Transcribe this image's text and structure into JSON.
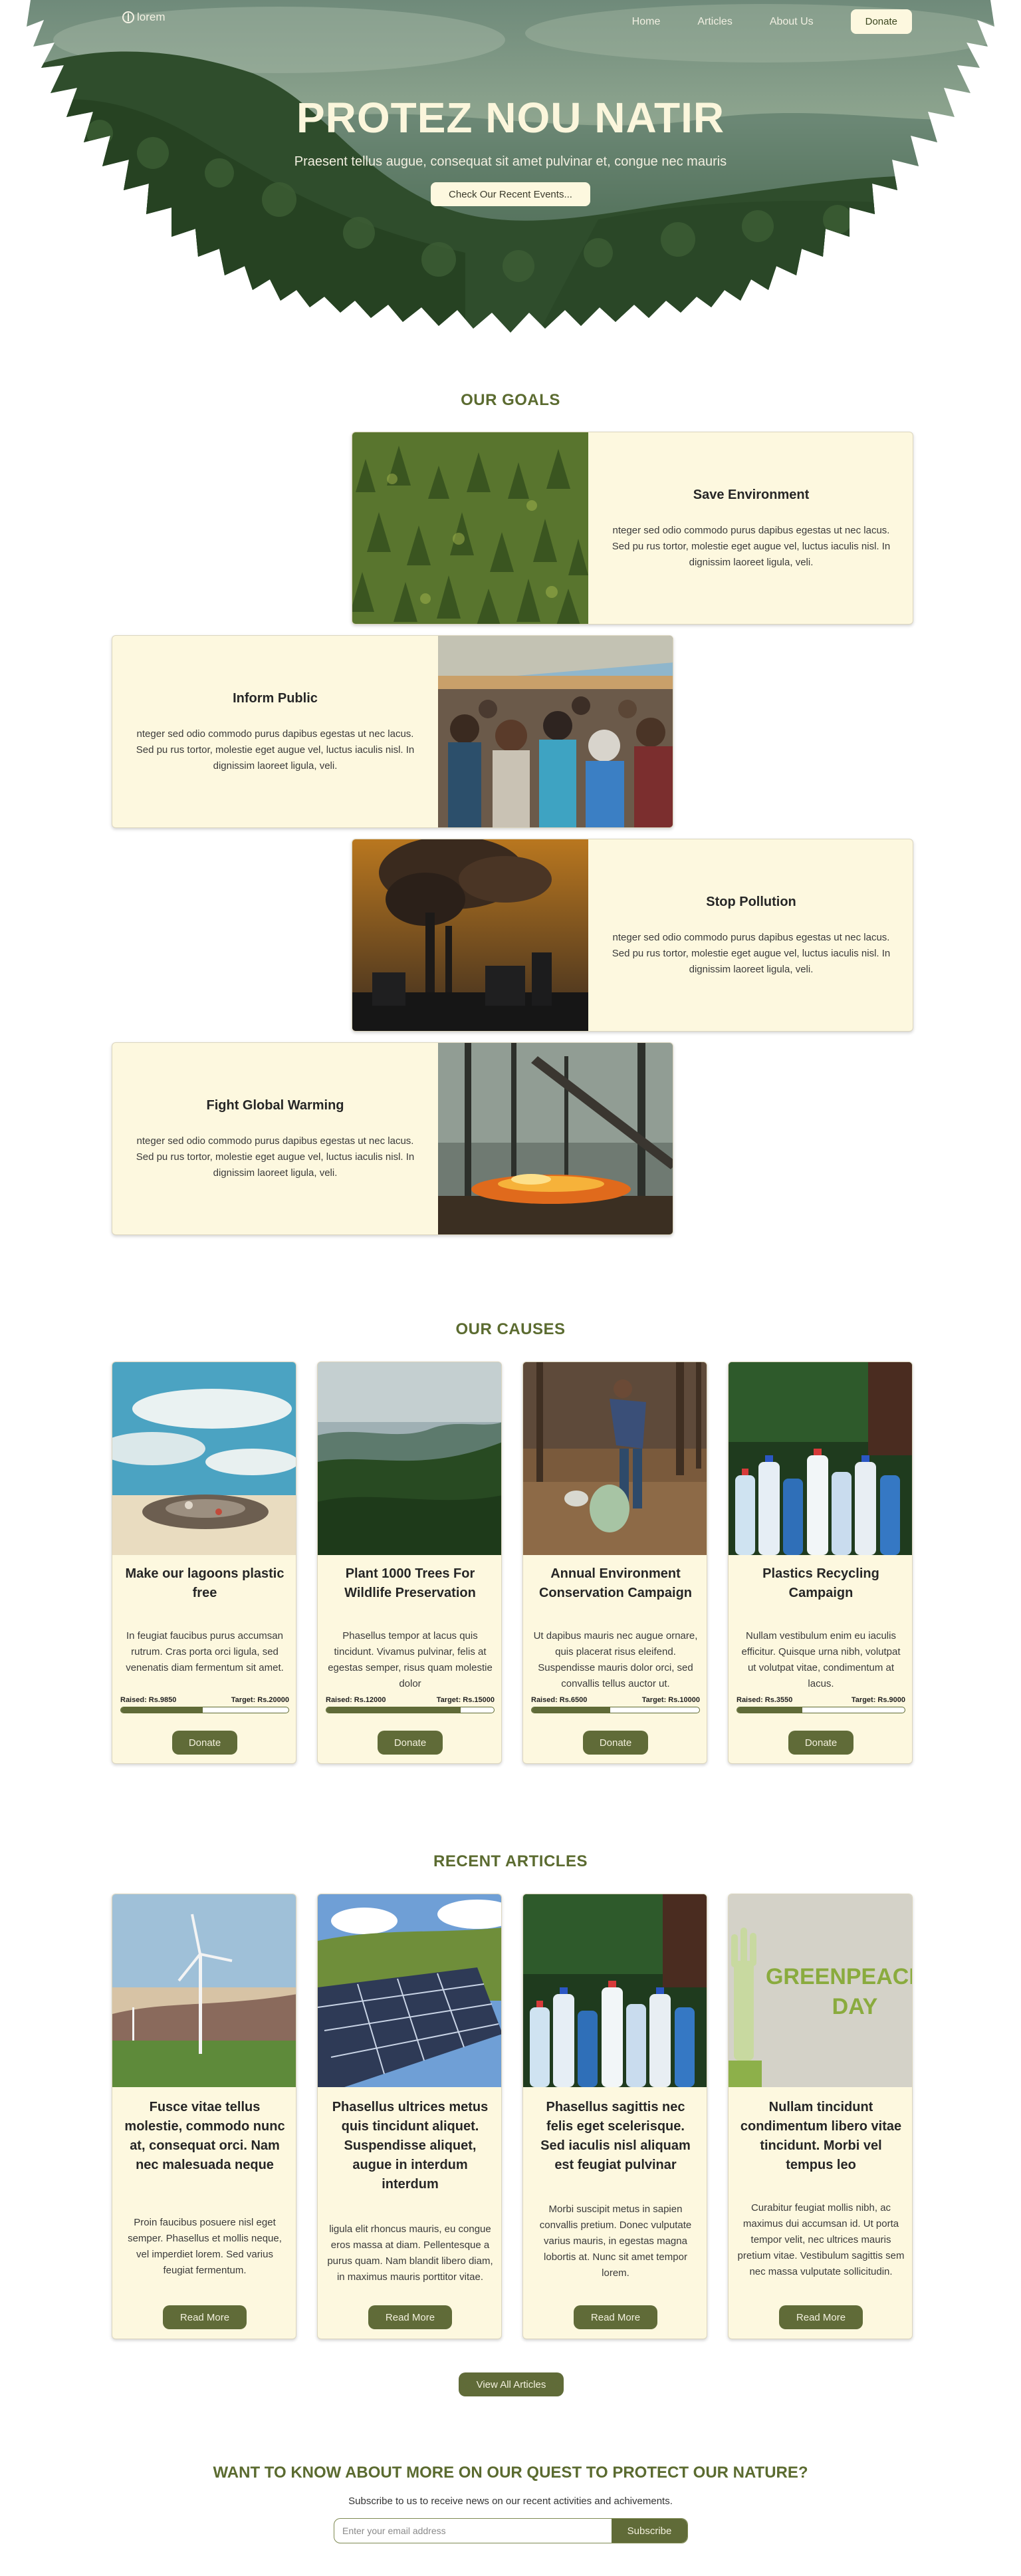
{
  "nav": {
    "logo_text": "lorem",
    "links": [
      "Home",
      "Articles",
      "About Us"
    ],
    "donate_label": "Donate"
  },
  "hero": {
    "title": "PROTEZ NOU NATIR",
    "subtitle": "Praesent tellus augue, consequat sit amet pulvinar et, congue nec mauris",
    "button": "Check Our Recent Events..."
  },
  "goals": {
    "title": "OUR GOALS",
    "items": [
      {
        "title": "Save Environment",
        "text": "nteger sed odio commodo purus dapibus egestas ut nec lacus. Sed pu rus tortor, molestie eget augue vel, luctus iaculis nisl. In dignissim laoreet ligula, veli.",
        "image": "pine-forest-photo"
      },
      {
        "title": "Inform Public",
        "text": "nteger sed odio commodo purus dapibus egestas ut nec lacus. Sed pu rus tortor, molestie eget augue vel, luctus iaculis nisl. In dignissim laoreet ligula, veli.",
        "image": "crowd-photo"
      },
      {
        "title": "Stop Pollution",
        "text": "nteger sed odio commodo purus dapibus egestas ut nec lacus. Sed pu rus tortor, molestie eget augue vel, luctus iaculis nisl. In dignissim laoreet ligula, veli.",
        "image": "factory-smoke-photo"
      },
      {
        "title": "Fight Global Warming",
        "text": "nteger sed odio commodo purus dapibus egestas ut nec lacus. Sed pu rus tortor, molestie eget augue vel, luctus iaculis nisl. In dignissim laoreet ligula, veli.",
        "image": "forest-fire-photo"
      }
    ]
  },
  "causes": {
    "title": "OUR CAUSES",
    "items": [
      {
        "title": "Make our lagoons plastic free",
        "text": "In feugiat faucibus purus accumsan rutrum. Cras porta orci ligula, sed venenatis diam fermentum sit amet.",
        "raised": "Raised: Rs.9850",
        "target": "Target: Rs.20000",
        "progress": 0.49,
        "button": "Donate",
        "image": "beach-trash-photo"
      },
      {
        "title": "Plant 1000 Trees For Wildlife Preservation",
        "text": "Phasellus tempor at lacus quis tincidunt. Vivamus pulvinar, felis at egestas semper, risus quam molestie dolor",
        "raised": "Raised: Rs.12000",
        "target": "Target: Rs.15000",
        "progress": 0.8,
        "button": "Donate",
        "image": "forest-valley-photo"
      },
      {
        "title": "Annual Environment Conservation Campaign",
        "text": "Ut dapibus mauris nec augue ornare, quis placerat risus eleifend. Suspendisse mauris dolor orci, sed convallis tellus auctor ut.",
        "raised": "Raised: Rs.6500",
        "target": "Target: Rs.10000",
        "progress": 0.47,
        "button": "Donate",
        "image": "volunteer-litter-photo"
      },
      {
        "title": "Plastics Recycling Campaign",
        "text": "Nullam vestibulum enim eu iaculis efficitur. Quisque urna nibh, volutpat ut volutpat vitae, condimentum at lacus.",
        "raised": "Raised: Rs.3550",
        "target": "Target: Rs.9000",
        "progress": 0.39,
        "button": "Donate",
        "image": "plastic-bottles-photo"
      }
    ]
  },
  "articles": {
    "title": "RECENT ARTICLES",
    "items": [
      {
        "title": "Fusce vitae tellus molestie, commodo nunc at, consequat orci. Nam nec malesuada neque",
        "text": "Proin faucibus posuere nisl eget semper. Phasellus et mollis neque, vel imperdiet lorem. Sed varius feugiat fermentum.",
        "button": "Read More",
        "image": "wind-turbine-photo"
      },
      {
        "title": "Phasellus ultrices metus quis tincidunt aliquet. Suspendisse aliquet, augue in interdum interdum",
        "text": "ligula elit rhoncus mauris, eu congue eros massa at diam. Pellentesque a purus quam. Nam blandit libero diam, in maximus mauris porttitor vitae.",
        "button": "Read More",
        "image": "solar-panels-photo"
      },
      {
        "title": "Phasellus sagittis nec felis eget scelerisque. Sed iaculis nisl aliquam est feugiat pulvinar",
        "text": "Morbi suscipit metus in sapien convallis pretium. Donec vulputate varius mauris, in egestas magna lobortis at. Nunc sit amet tempor lorem.",
        "button": "Read More",
        "image": "plastic-bottles-photo"
      },
      {
        "title": "Nullam tincidunt condimentum libero vitae tincidunt. Morbi vel tempus leo",
        "text": "Curabitur feugiat mollis nibh, ac maximus dui accumsan id. Ut porta tempor velit, nec ultrices mauris pretium vitae. Vestibulum sagittis sem nec massa vulputate sollicitudin.",
        "button": "Read More",
        "image": "greenpeace-day-poster",
        "poster_text": [
          "GREENPEACE",
          "DAY"
        ]
      }
    ],
    "view_all": "View All Articles"
  },
  "newsletter": {
    "title": "WANT TO KNOW ABOUT MORE ON OUR QUEST TO PROTECT OUR NATURE?",
    "subtitle": "Subscribe to us to receive news on our recent activities and achivements.",
    "placeholder": "Enter your email address",
    "button": "Subscribe"
  },
  "colors": {
    "accent": "#606b38",
    "heading": "#5b6b30",
    "card_bg": "#fdf8df",
    "hero_forest": "#34502f"
  }
}
